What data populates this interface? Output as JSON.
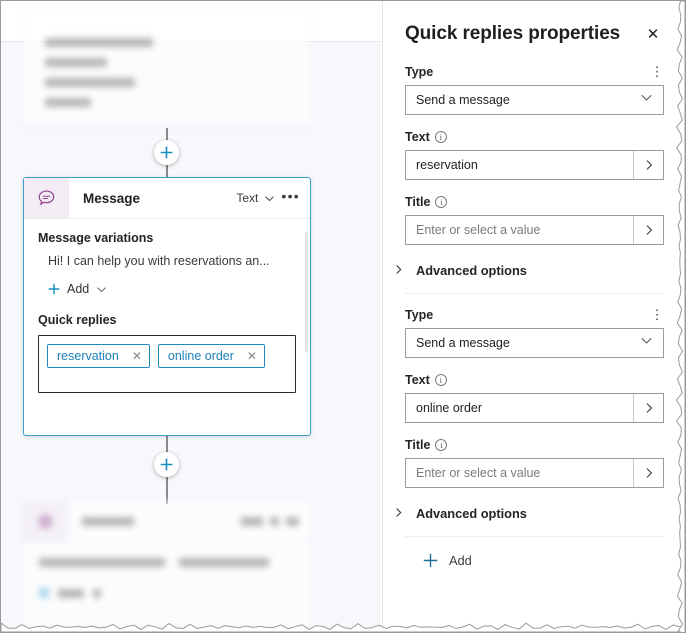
{
  "canvas": {
    "plus_button_top": {
      "icon": "plus-icon",
      "label": "+"
    },
    "plus_button_bottom": {
      "icon": "plus-icon",
      "label": "+"
    },
    "message_node": {
      "icon": "message-bubble-icon",
      "title": "Message",
      "type_label": "Text",
      "type_caret": "chevron-down-icon",
      "more_menu": "•••",
      "variations_label": "Message variations",
      "variation_text": "Hi! I can help you with reservations an...",
      "add_label": "Add",
      "add_icon": "plus-icon",
      "add_caret": "chevron-down-icon",
      "quick_replies_label": "Quick replies",
      "chips": [
        {
          "text": "reservation",
          "remove_icon": "close-icon",
          "remove_glyph": "✕"
        },
        {
          "text": "online order",
          "remove_icon": "close-icon",
          "remove_glyph": "✕"
        }
      ]
    }
  },
  "panel": {
    "title": "Quick replies properties",
    "close_icon": "close-icon",
    "close_glyph": "✕",
    "add_label": "Add",
    "add_icon": "plus-icon",
    "groups": [
      {
        "type_label": "Type",
        "type_value": "Send a message",
        "text_label": "Text",
        "text_value": "reservation",
        "title_label": "Title",
        "title_placeholder": "Enter or select a value",
        "advanced_label": "Advanced options"
      },
      {
        "type_label": "Type",
        "type_value": "Send a message",
        "text_label": "Text",
        "text_value": "online order",
        "title_label": "Title",
        "title_placeholder": "Enter or select a value",
        "advanced_label": "Advanced options"
      }
    ]
  },
  "colors": {
    "accent_blue": "#0f7ab5",
    "node_border": "#3c9ec6",
    "icon_purple": "#8c3f8c",
    "icon_bg": "#f4ecf4",
    "canvas_bg": "#f6f8fc"
  }
}
